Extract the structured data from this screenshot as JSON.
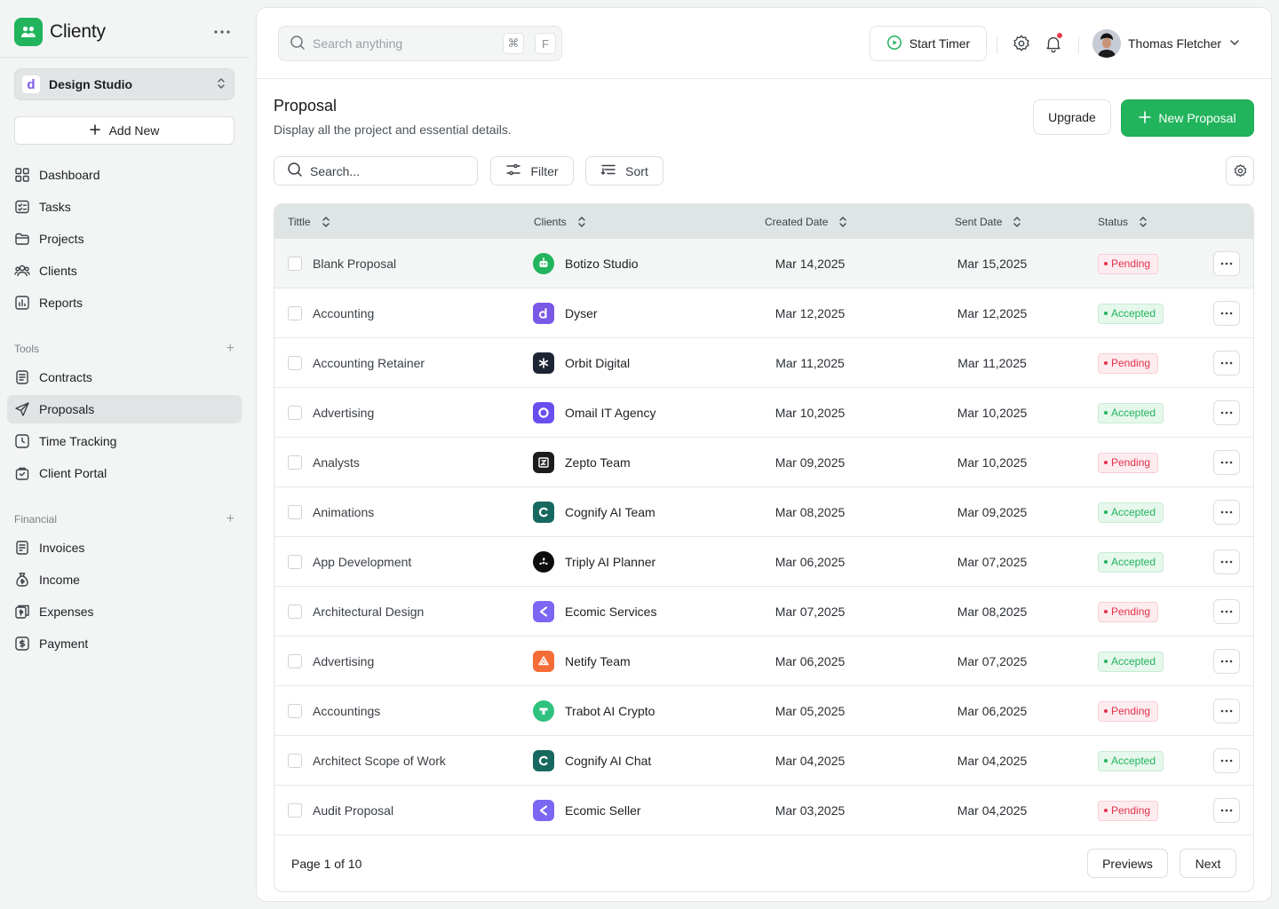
{
  "app": {
    "name": "Clienty"
  },
  "workspace": {
    "initial": "d",
    "name": "Design Studio"
  },
  "sidebar": {
    "add_new_label": "Add New",
    "main_items": [
      {
        "label": "Dashboard",
        "icon": "grid-icon"
      },
      {
        "label": "Tasks",
        "icon": "checklist-icon"
      },
      {
        "label": "Projects",
        "icon": "folder-icon"
      },
      {
        "label": "Clients",
        "icon": "users-icon"
      },
      {
        "label": "Reports",
        "icon": "chart-icon"
      }
    ],
    "tools_label": "Tools",
    "tools_items": [
      {
        "label": "Contracts",
        "icon": "document-icon"
      },
      {
        "label": "Proposals",
        "icon": "send-icon",
        "active": true
      },
      {
        "label": "Time Tracking",
        "icon": "clock-icon"
      },
      {
        "label": "Client Portal",
        "icon": "portal-icon"
      }
    ],
    "financial_label": "Financial",
    "financial_items": [
      {
        "label": "Invoices",
        "icon": "invoice-icon"
      },
      {
        "label": "Income",
        "icon": "money-bag-icon"
      },
      {
        "label": "Expenses",
        "icon": "expenses-icon"
      },
      {
        "label": "Payment",
        "icon": "dollar-icon"
      }
    ]
  },
  "topbar": {
    "search_placeholder": "Search anything",
    "shortcut_keys": [
      "⌘",
      "F"
    ],
    "start_timer_label": "Start Timer",
    "user_name": "Thomas Fletcher"
  },
  "page": {
    "title": "Proposal",
    "subtitle": "Display all the project and essential details.",
    "upgrade_label": "Upgrade",
    "new_label": "New Proposal",
    "search_placeholder": "Search...",
    "filter_label": "Filter",
    "sort_label": "Sort"
  },
  "table": {
    "columns": [
      "Tittle",
      "Clients",
      "Created Date",
      "Sent Date",
      "Status"
    ],
    "rows": [
      {
        "title": "Blank Proposal",
        "client": "Botizo Studio",
        "logo": "botizo",
        "created": "Mar 14,2025",
        "sent": "Mar 15,2025",
        "status": "Pending"
      },
      {
        "title": "Accounting",
        "client": "Dyser",
        "logo": "dyser",
        "created": "Mar 12,2025",
        "sent": "Mar 12,2025",
        "status": "Accepted"
      },
      {
        "title": "Accounting Retainer",
        "client": "Orbit Digital",
        "logo": "orbit",
        "created": "Mar 11,2025",
        "sent": "Mar 11,2025",
        "status": "Pending"
      },
      {
        "title": "Advertising",
        "client": "Omail IT Agency",
        "logo": "omail",
        "created": "Mar 10,2025",
        "sent": "Mar 10,2025",
        "status": "Accepted"
      },
      {
        "title": "Analysts",
        "client": "Zepto Team",
        "logo": "zepto",
        "created": "Mar 09,2025",
        "sent": "Mar 10,2025",
        "status": "Pending"
      },
      {
        "title": "Animations",
        "client": "Cognify AI Team",
        "logo": "cognify",
        "created": "Mar 08,2025",
        "sent": "Mar 09,2025",
        "status": "Accepted"
      },
      {
        "title": "App Development",
        "client": "Triply AI Planner",
        "logo": "triply",
        "created": "Mar 06,2025",
        "sent": "Mar 07,2025",
        "status": "Accepted"
      },
      {
        "title": "Architectural Design",
        "client": "Ecomic Services",
        "logo": "ecomic",
        "created": "Mar 07,2025",
        "sent": "Mar 08,2025",
        "status": "Pending"
      },
      {
        "title": "Advertising",
        "client": "Netify Team",
        "logo": "netify",
        "created": "Mar 06,2025",
        "sent": "Mar 07,2025",
        "status": "Accepted"
      },
      {
        "title": "Accountings",
        "client": "Trabot AI Crypto",
        "logo": "trabot",
        "created": "Mar 05,2025",
        "sent": "Mar 06,2025",
        "status": "Pending"
      },
      {
        "title": "Architect Scope of Work",
        "client": "Cognify AI Chat",
        "logo": "cognify",
        "created": "Mar 04,2025",
        "sent": "Mar 04,2025",
        "status": "Accepted"
      },
      {
        "title": "Audit Proposal",
        "client": "Ecomic Seller",
        "logo": "ecomic",
        "created": "Mar 03,2025",
        "sent": "Mar 04,2025",
        "status": "Pending"
      }
    ],
    "page_info": "Page 1 of 10",
    "prev_label": "Previews",
    "next_label": "Next"
  },
  "colors": {
    "accent": "#22b45c",
    "pending": "#e1324a",
    "accepted": "#22b45c"
  }
}
